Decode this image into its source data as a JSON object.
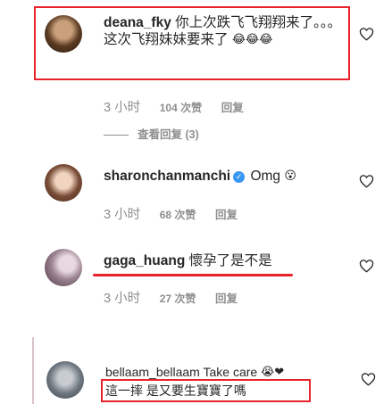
{
  "comments": [
    {
      "username": "deana_fky",
      "text": "你上次跌飞飞翔翔来了。。。这次飞翔妹妹要来了",
      "emoji": "😂😂😂",
      "time": "3 小时",
      "likes": "104 次赞",
      "reply_label": "回复",
      "view_replies": "查看回复 (3)"
    },
    {
      "username": "sharonchanmanchi",
      "text": "Omg",
      "emoji": "😮",
      "time": "3 小时",
      "likes": "68 次赞",
      "reply_label": "回复"
    },
    {
      "username": "gaga_huang",
      "text": "懷孕了是不是",
      "time": "3 小时",
      "likes": "27 次赞",
      "reply_label": "回复"
    },
    {
      "username": "bellaam_bellaam",
      "text": "Take care",
      "emoji": "😭❤",
      "text_line2": "這一摔 是又要生寶寶了嗎"
    }
  ],
  "colors": {
    "highlight": "#e8232b",
    "meta": "#8e8e8e",
    "text": "#262626",
    "verified": "#3897f0"
  },
  "icons": {
    "heart": "heart-outline-icon",
    "verified": "verified-badge-icon"
  }
}
